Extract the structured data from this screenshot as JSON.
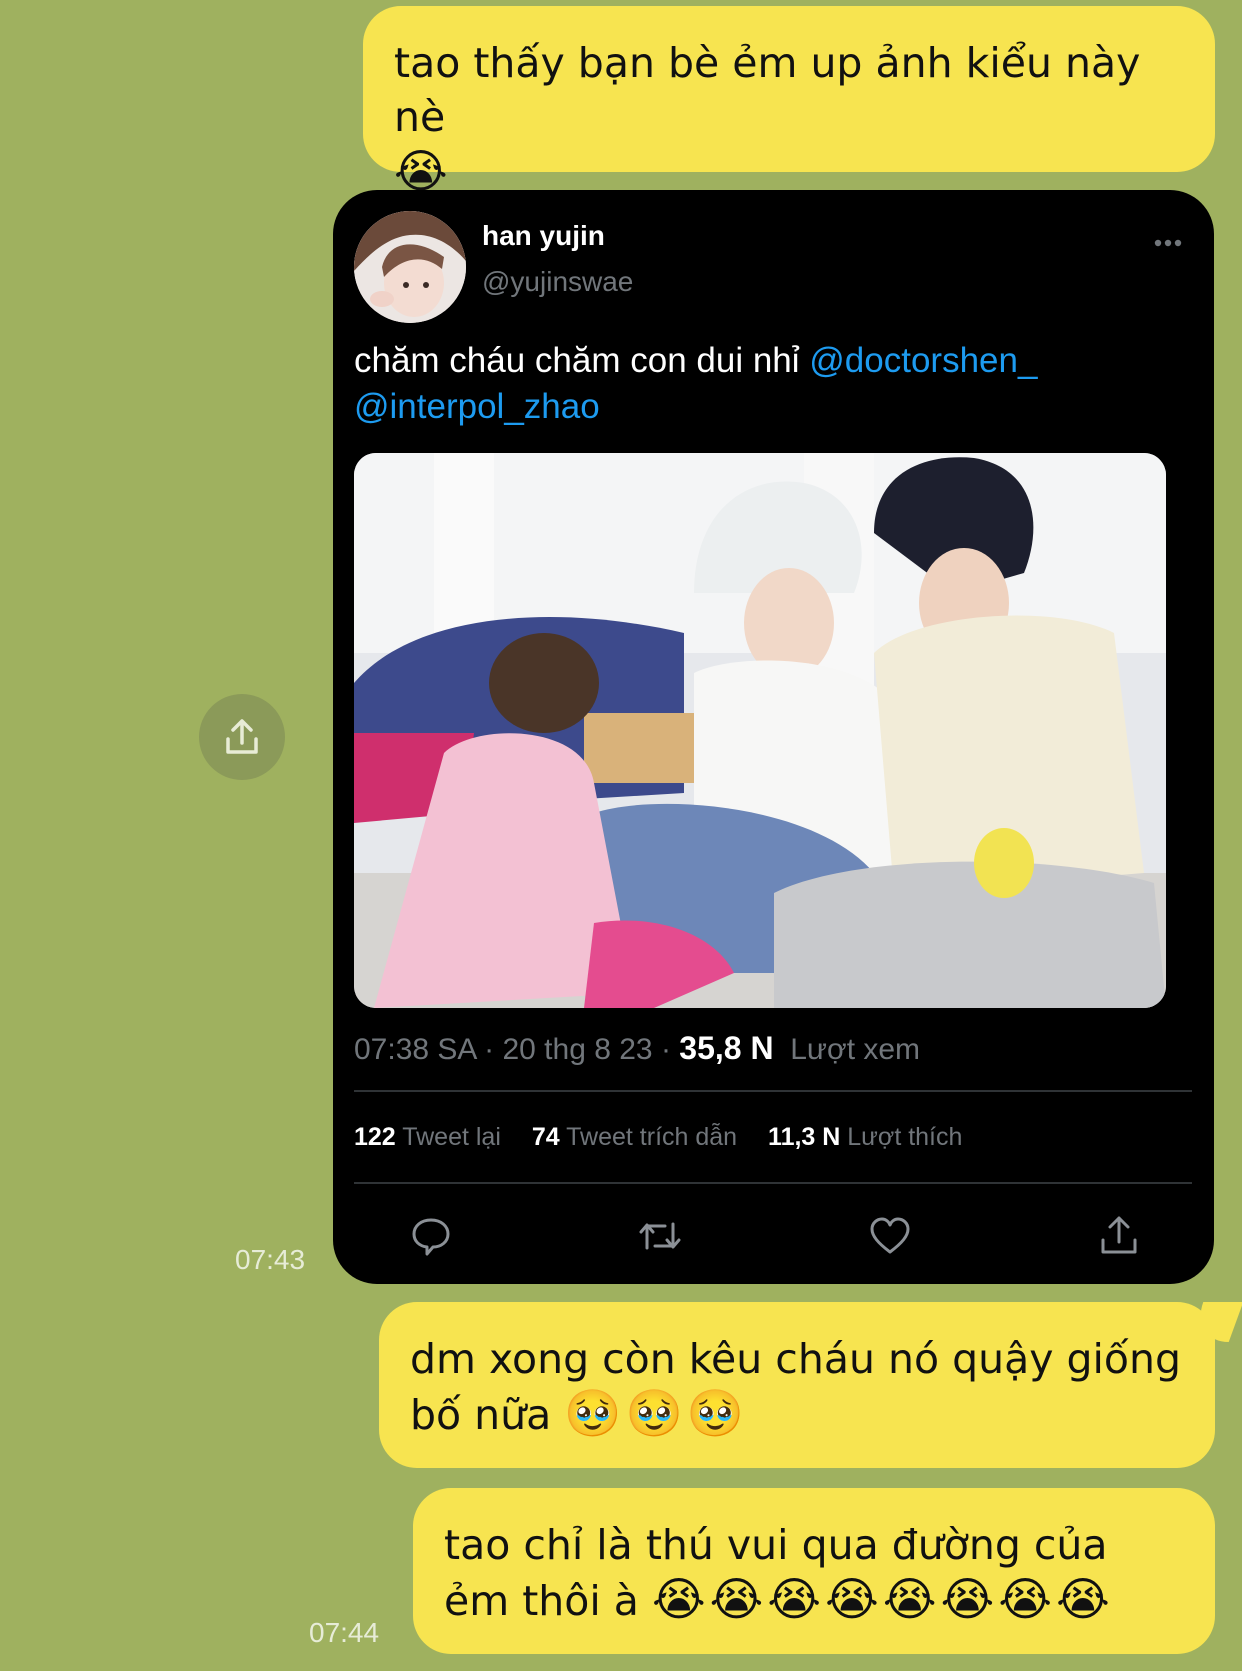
{
  "messages": [
    {
      "text": "tao thấy bạn bè ẻm up ảnh kiểu này nè",
      "emoji": "😭"
    },
    {
      "text": "dm xong còn kêu cháu nó quậy giống bố nữa",
      "emoji": "🥹🥹🥹"
    },
    {
      "text": "tao chỉ là thú vui qua đường của ẻm thôi à",
      "emoji": "😭😭😭😭😭😭😭😭"
    }
  ],
  "timestamps": {
    "tweet": "07:43",
    "last": "07:44"
  },
  "tweet": {
    "name": "han yujin",
    "handle": "@yujinswae",
    "text": "chăm cháu chăm con dui nhỉ",
    "mention1": "@doctorshen_",
    "mention2": "@interpol_zhao",
    "time": "07:38 SA",
    "date": "20 thg 8 23",
    "sep": "·",
    "views_count": "35,8 N",
    "views_label": "Lượt xem",
    "retweets_count": "122",
    "retweets_label": "Tweet lại",
    "quotes_count": "74",
    "quotes_label": "Tweet trích dẫn",
    "likes_count": "11,3 N",
    "likes_label": "Lượt thích"
  },
  "icons": {
    "share_float": "share-icon",
    "reply": "reply-icon",
    "retweet": "retweet-icon",
    "like": "heart-icon",
    "share": "share-icon",
    "more": "more-icon"
  },
  "colors": {
    "background": "#9fb15f",
    "bubble": "#f7e450",
    "mention": "#1d9bf0",
    "tweet_bg": "#000000"
  }
}
